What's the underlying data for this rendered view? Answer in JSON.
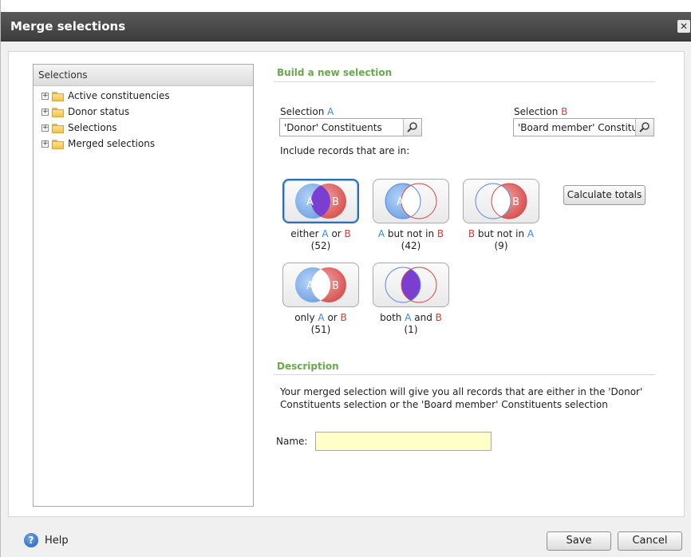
{
  "window": {
    "title": "Merge selections",
    "close_glyph": "✕"
  },
  "tree": {
    "header": "Selections",
    "items": [
      {
        "label": "Active constituencies"
      },
      {
        "label": "Donor status"
      },
      {
        "label": "Selections"
      },
      {
        "label": "Merged selections"
      }
    ]
  },
  "build": {
    "title": "Build a new selection",
    "selection_a": {
      "label": "Selection",
      "letter": "A",
      "value": "'Donor' Constituents"
    },
    "selection_b": {
      "label": "Selection",
      "letter": "B",
      "value": "'Board member' Constituents"
    },
    "include_label": "Include records that are in:",
    "options": [
      {
        "pre": "either ",
        "a": "A",
        "mid": " or ",
        "b": "B",
        "count": "(52)",
        "selected": true
      },
      {
        "pre": "",
        "a": "A",
        "mid": " but not in ",
        "b": "B",
        "count": "(42)",
        "selected": false
      },
      {
        "pre": "",
        "a": "B",
        "mid": " but not in ",
        "b": "A",
        "count": "(9)",
        "selected": false
      },
      {
        "pre": "only ",
        "a": "A",
        "mid": " or ",
        "b": "B",
        "count": "(51)",
        "selected": false
      },
      {
        "pre": "both ",
        "a": "A",
        "mid": " and ",
        "b": "B",
        "count": "(1)",
        "selected": false
      }
    ],
    "calculate_label": "Calculate totals"
  },
  "description": {
    "title": "Description",
    "text_line1": "Your merged selection will give you all records that are either in the 'Donor'",
    "text_line2": "Constituents selection or the 'Board member' Constituents selection"
  },
  "name_field": {
    "label": "Name:",
    "value": ""
  },
  "footer": {
    "help_label": "Help",
    "save_label": "Save",
    "cancel_label": "Cancel"
  },
  "colors": {
    "a": "#3b86d6",
    "b": "#d23a3a",
    "section": "#6aa84f",
    "name_bg": "#ffffc8"
  },
  "icons": [
    "expand-plus-icon",
    "folder-icon",
    "search-icon",
    "help-icon",
    "close-icon"
  ]
}
